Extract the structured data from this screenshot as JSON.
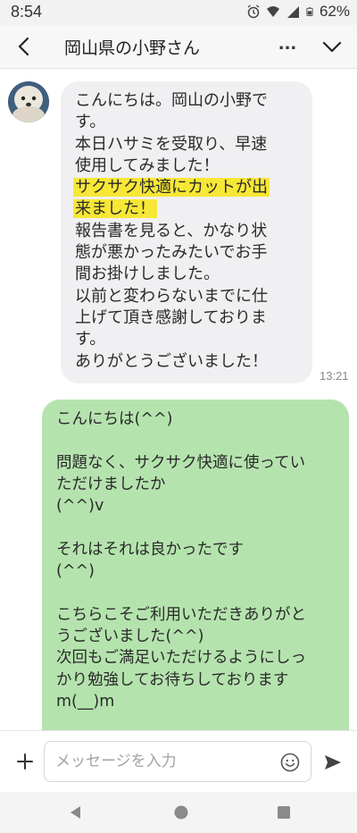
{
  "status_bar": {
    "time": "8:54",
    "battery": "62%",
    "icons": [
      "alarm-icon",
      "wifi-icon",
      "signal-icon",
      "battery-icon"
    ]
  },
  "header": {
    "title": "岡山県の小野さん",
    "more_label": "..."
  },
  "incoming": {
    "lines": [
      "こんにちは。岡山の小野で",
      "す。",
      "本日ハサミを受取り、早速",
      "使用してみました！",
      "サクサク快適にカットが出",
      "来ました！",
      "報告書を見ると、かなり状",
      "態が悪かったみたいでお手",
      "間お掛けしました。",
      "以前と変わらないまでに仕",
      "上げて頂き感謝しておりま",
      "す。",
      "ありがとうございました！"
    ],
    "time": "13:21",
    "highlight_color": "#f7e736"
  },
  "outgoing": {
    "lines": [
      "こんにちは(^^)",
      "",
      "問題なく、サクサク快適に使ってい",
      "ただけましたか",
      "(^^)v",
      "",
      "それはそれは良かったです",
      "(^^)",
      "",
      "こちらこそご利用いただきありがと",
      "うございました(^^)",
      "次回もご満足いただけるようにしっ",
      "かり勉強してお待ちしております",
      "m(__)m"
    ],
    "bubble_color": "#b5e3ae"
  },
  "input": {
    "placeholder": "メッセージを入力",
    "value": ""
  },
  "colors": {
    "incoming_bubble": "#f0f0f2",
    "outgoing_bubble": "#b5e3ae",
    "send_icon": "#444444"
  }
}
